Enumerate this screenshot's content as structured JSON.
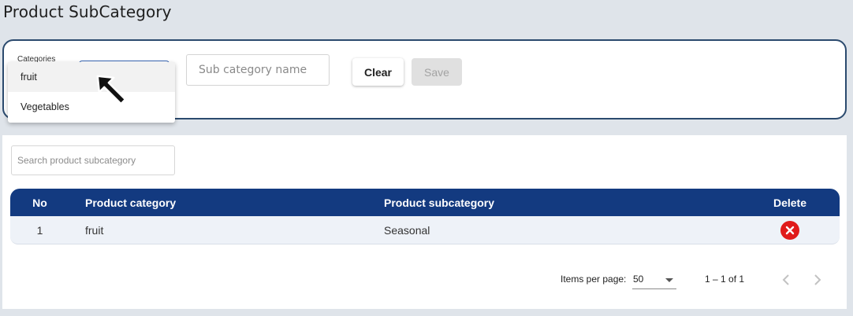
{
  "page": {
    "title": "Product SubCategory"
  },
  "form": {
    "category_label": "Categories",
    "subcategory_placeholder": "Sub category name",
    "clear_label": "Clear",
    "save_label": "Save",
    "dropdown_options": [
      "fruit",
      "Vegetables"
    ]
  },
  "table": {
    "search_placeholder": "Search product subcategory",
    "columns": {
      "no": "No",
      "category": "Product category",
      "subcategory": "Product subcategory",
      "delete": "Delete"
    },
    "rows": [
      {
        "no": "1",
        "category": "fruit",
        "subcategory": "Seasonal"
      }
    ]
  },
  "paginator": {
    "items_per_page_label": "Items per page:",
    "items_per_page_value": "50",
    "range_label": "1 – 1 of 1"
  },
  "colors": {
    "header_bg": "#133a80",
    "delete_red": "#e01b1b",
    "form_border": "#2b4a6e"
  }
}
